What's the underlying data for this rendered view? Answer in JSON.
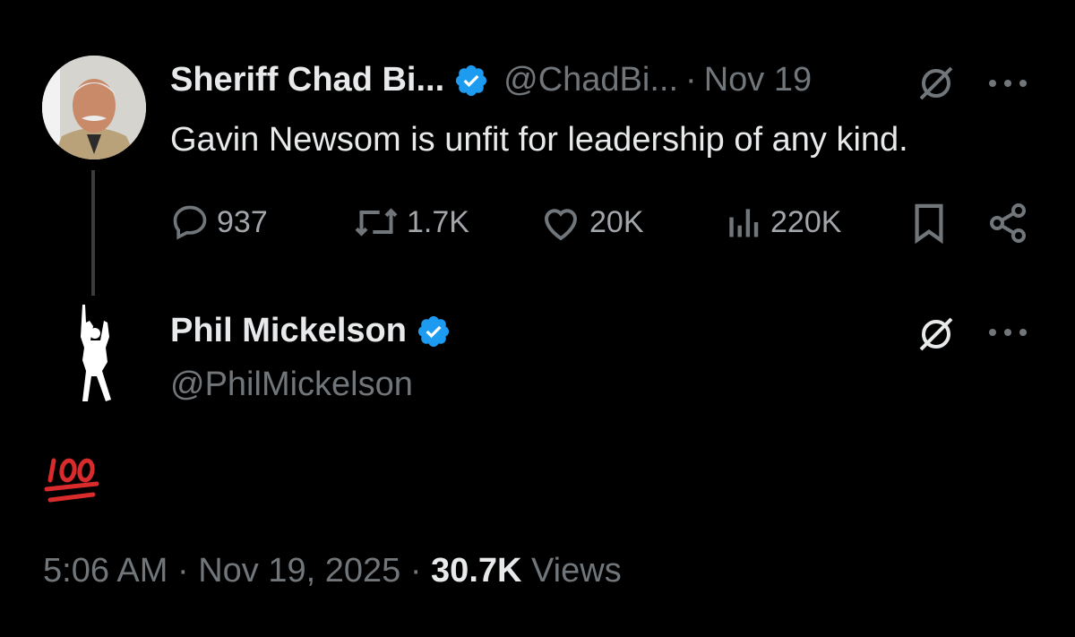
{
  "parent_tweet": {
    "author_name": "Sheriff Chad Bi...",
    "handle": "@ChadBi...",
    "separator": "·",
    "date": "Nov 19",
    "text": "Gavin Newsom is unfit for leadership of any kind.",
    "metrics": {
      "replies": "937",
      "reposts": "1.7K",
      "likes": "20K",
      "views": "220K"
    }
  },
  "reply_tweet": {
    "author_name": "Phil Mickelson",
    "handle": "@PhilMickelson",
    "emoji": "100-emoji"
  },
  "footer": {
    "time": "5:06 AM",
    "separator": "·",
    "date": "Nov 19, 2025",
    "views_count": "30.7K",
    "views_label": "Views"
  },
  "colors": {
    "background": "#000000",
    "text_primary": "#e7e9ea",
    "text_secondary": "#71767b",
    "verified_badge": "#1d9bf0",
    "emoji_red": "#d92b2b"
  }
}
